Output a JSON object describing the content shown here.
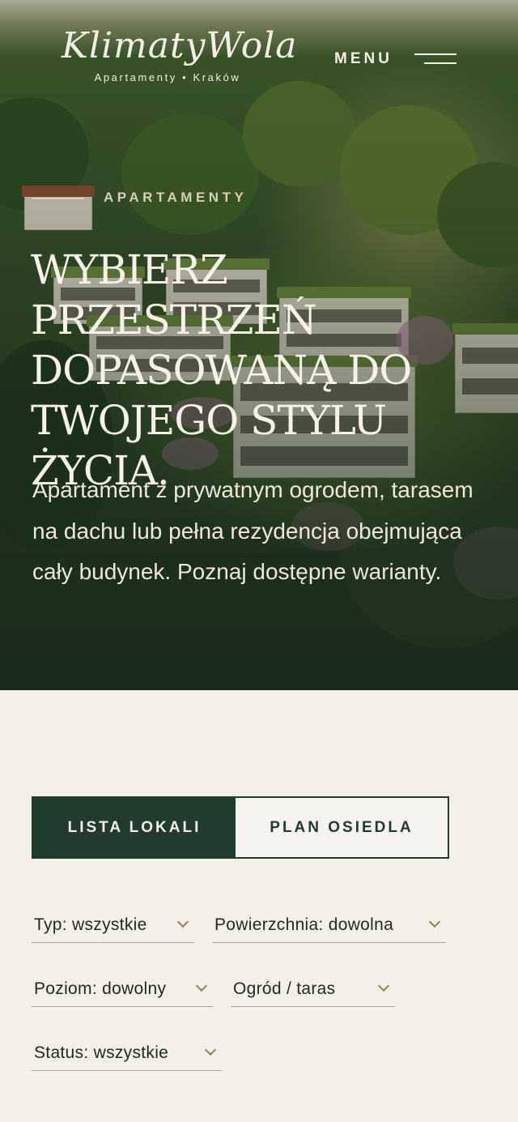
{
  "header": {
    "logo_script": "KlimatyWola",
    "logo_subtitle": "Apartamenty • Kraków",
    "menu_label": "MENU"
  },
  "hero": {
    "eyebrow": "APARTAMENTY",
    "headline": "Wybierz przestrzeń dopasowaną do Twojego stylu życia.",
    "lead": "Apartament z prywatnym ogrodem, tarasem na dachu lub pełna rezydencja obejmująca cały budynek. Poznaj dostępne warianty."
  },
  "tabs": [
    {
      "label": "LISTA LOKALI",
      "active": true
    },
    {
      "label": "PLAN OSIEDLA",
      "active": false
    }
  ],
  "filters": {
    "type": "Typ: wszystkie",
    "area": "Powierzchnia: dowolna",
    "level": "Poziom: dowolny",
    "garden": "Ogród / taras",
    "status": "Status: wszystkie"
  },
  "colors": {
    "brand_dark_green": "#213c2d",
    "page_background": "#f2f0e8",
    "accent_chevron": "#a47c4c"
  }
}
